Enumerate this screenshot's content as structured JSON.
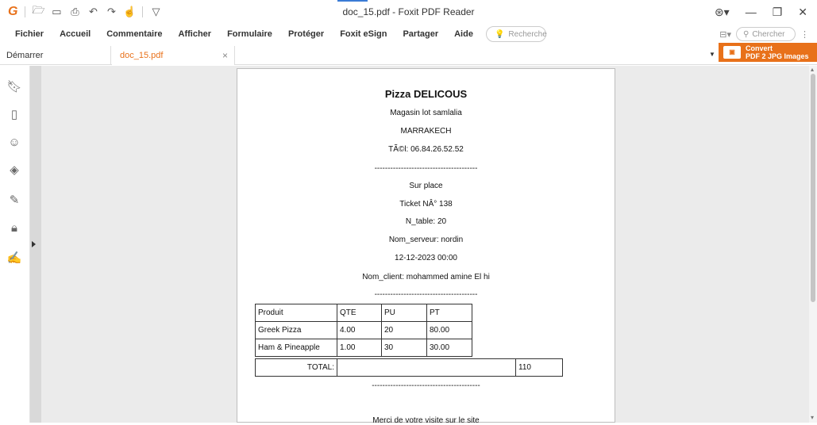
{
  "titlebar": {
    "window_title": "doc_15.pdf - Foxit PDF Reader",
    "logo": "G"
  },
  "menu": {
    "items": [
      "Fichier",
      "Accueil",
      "Commentaire",
      "Afficher",
      "Formulaire",
      "Protéger",
      "Foxit eSign",
      "Partager",
      "Aide"
    ],
    "search_placeholder": "Recherche",
    "find_placeholder": "Chercher"
  },
  "tabs": {
    "start": "Démarrer",
    "doc": "doc_15.pdf",
    "close": "×"
  },
  "convert": {
    "line1": "Convert",
    "line2": "PDF 2 JPG Images"
  },
  "receipt": {
    "title": "Pizza DELICOUS",
    "line1": "Magasin lot samlalia",
    "line2": "MARRAKECH",
    "line3": "TÃ©l: 06.84.26.52.52",
    "separator": "---------------------------------------",
    "mode": "Sur place",
    "ticket": "Ticket NÂ° 138",
    "table": "N_table: 20",
    "server": "Nom_serveur: nordin",
    "datetime": "12-12-2023 00:00",
    "client": "Nom_client: mohammed amine El hi",
    "separator2": "---------------------------------------",
    "headers": [
      "Produit",
      "QTE",
      "PU",
      "PT"
    ],
    "rows": [
      [
        "Greek Pizza",
        "4.00",
        "20",
        "80.00"
      ],
      [
        "Ham & Pineapple",
        "1.00",
        "30",
        "30.00"
      ]
    ],
    "total_label": "TOTAL:",
    "total_value": "110",
    "separator3": "-----------------------------------------",
    "footer": "Merci de votre visite sur le site"
  }
}
